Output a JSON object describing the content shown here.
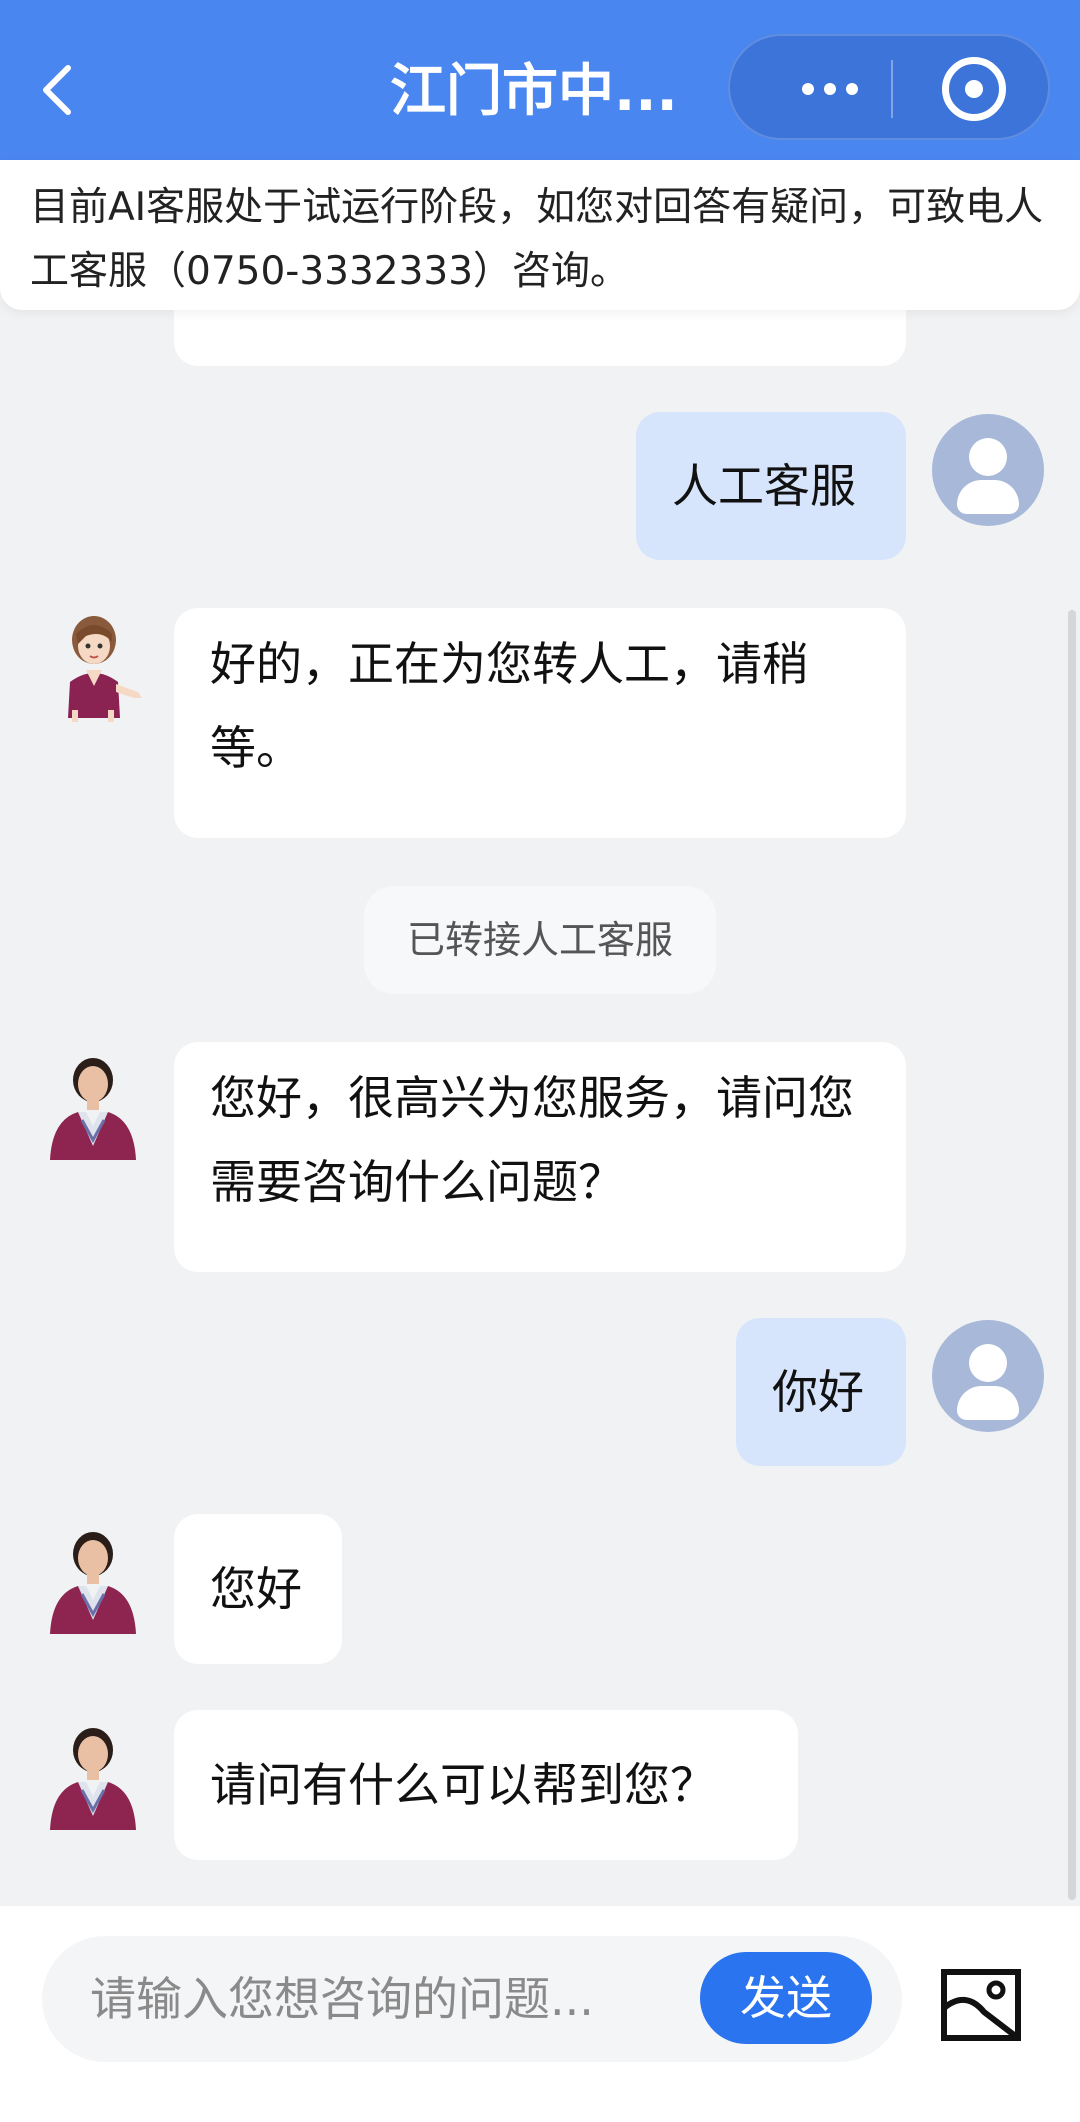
{
  "header": {
    "title": "江门市中...",
    "back_icon": "chevron-left-icon",
    "more_icon": "more-dots-icon",
    "close_icon": "target-circle-icon",
    "bg_color": "#4a86f0"
  },
  "notice": {
    "text": "目前AI客服处于试运行阶段，如您对回答有疑问，可致电人工客服（0750-3332333）咨询。"
  },
  "messages": [
    {
      "role": "user",
      "text": "人工客服"
    },
    {
      "role": "agent",
      "text": "好的，正在为您转人工，请稍等。"
    },
    {
      "role": "system",
      "text": "已转接人工客服"
    },
    {
      "role": "agent",
      "text": "您好，很高兴为您服务，请问您需要咨询什么问题？"
    },
    {
      "role": "user",
      "text": "你好"
    },
    {
      "role": "agent",
      "text": "您好"
    },
    {
      "role": "agent",
      "text": "请问有什么可以帮到您？"
    }
  ],
  "composer": {
    "placeholder": "请输入您想咨询的问题...",
    "send_label": "发送",
    "image_icon": "image-picker-icon",
    "accent_color": "#2a74ef"
  }
}
